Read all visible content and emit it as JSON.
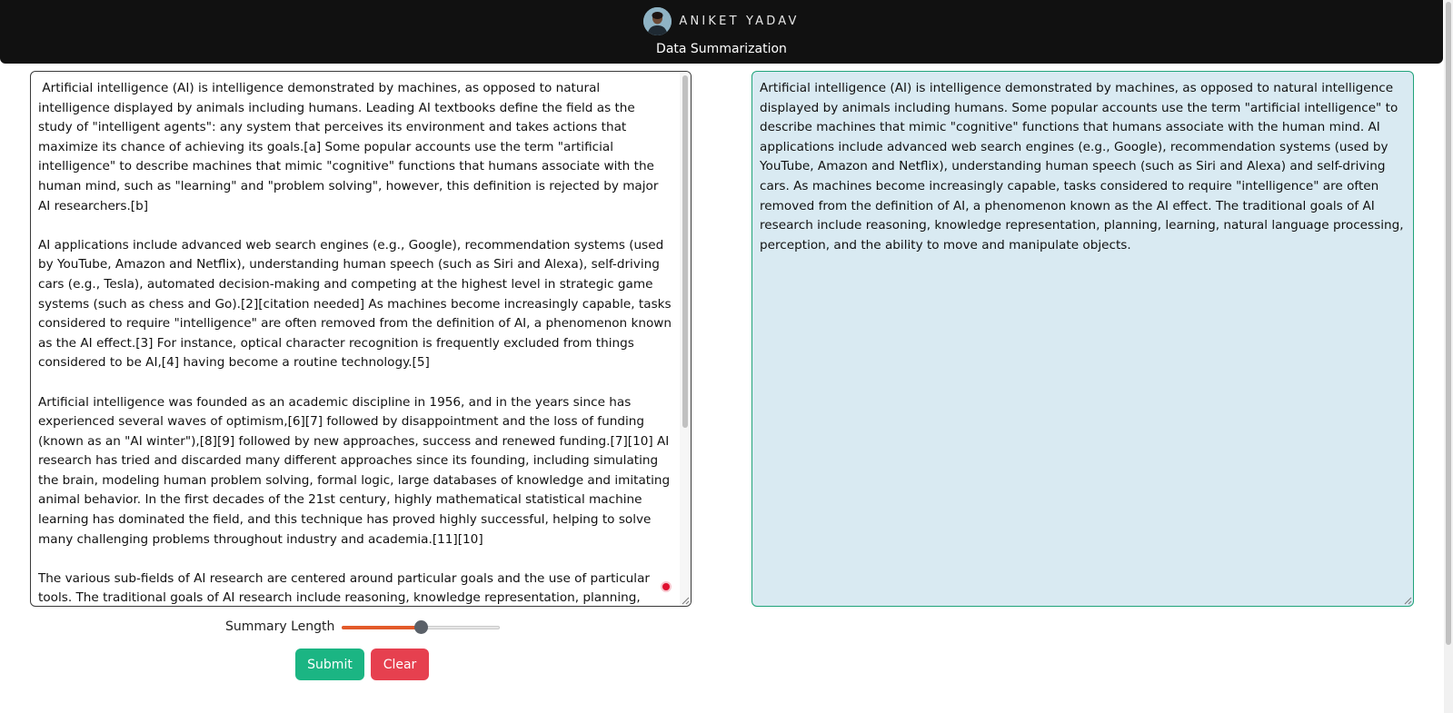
{
  "header": {
    "brand_name": "ANIKET YADAV",
    "subtitle": "Data Summarization",
    "avatar_icon": "user-avatar-photo"
  },
  "input": {
    "text": " Artificial intelligence (AI) is intelligence demonstrated by machines, as opposed to natural intelligence displayed by animals including humans. Leading AI textbooks define the field as the study of \"intelligent agents\": any system that perceives its environment and takes actions that maximize its chance of achieving its goals.[a] Some popular accounts use the term \"artificial intelligence\" to describe machines that mimic \"cognitive\" functions that humans associate with the human mind, such as \"learning\" and \"problem solving\", however, this definition is rejected by major AI researchers.[b]\n\nAI applications include advanced web search engines (e.g., Google), recommendation systems (used by YouTube, Amazon and Netflix), understanding human speech (such as Siri and Alexa), self-driving cars (e.g., Tesla), automated decision-making and competing at the highest level in strategic game systems (such as chess and Go).[2][citation needed] As machines become increasingly capable, tasks considered to require \"intelligence\" are often removed from the definition of AI, a phenomenon known as the AI effect.[3] For instance, optical character recognition is frequently excluded from things considered to be AI,[4] having become a routine technology.[5]\n\nArtificial intelligence was founded as an academic discipline in 1956, and in the years since has experienced several waves of optimism,[6][7] followed by disappointment and the loss of funding (known as an \"AI winter\"),[8][9] followed by new approaches, success and renewed funding.[7][10] AI research has tried and discarded many different approaches since its founding, including simulating the brain, modeling human problem solving, formal logic, large databases of knowledge and imitating animal behavior. In the first decades of the 21st century, highly mathematical statistical machine learning has dominated the field, and this technique has proved highly successful, helping to solve many challenging problems throughout industry and academia.[11][10]\n\nThe various sub-fields of AI research are centered around particular goals and the use of particular tools. The traditional goals of AI research include reasoning, knowledge representation, planning, learning, natural language processing, perception, and the ability to move and manipulate objects.[c] General"
  },
  "output": {
    "text": "Artificial intelligence (AI) is intelligence demonstrated by machines, as opposed to natural intelligence displayed by animals including humans. Some popular accounts use the term \"artificial intelligence\" to describe machines that mimic \"cognitive\" functions that humans associate with the human mind. AI applications include advanced web search engines (e.g., Google), recommendation systems (used by YouTube, Amazon and Netflix), understanding human speech (such as Siri and Alexa) and self-driving cars. As machines become increasingly capable, tasks considered to require \"intelligence\" are often removed from the definition of AI, a phenomenon known as the AI effect. The traditional goals of AI research include reasoning, knowledge representation, planning, learning, natural language processing, perception, and the ability to move and manipulate objects."
  },
  "controls": {
    "slider_label": "Summary Length",
    "slider_value_fraction": 0.5,
    "slider_fill_color": "#e35a2a",
    "submit_label": "Submit",
    "clear_label": "Clear",
    "submit_color": "#1bb583",
    "clear_color": "#e6404f"
  },
  "colors": {
    "header_bg": "#111111",
    "output_bg": "#d9eaf2",
    "output_border": "#20a37a"
  }
}
